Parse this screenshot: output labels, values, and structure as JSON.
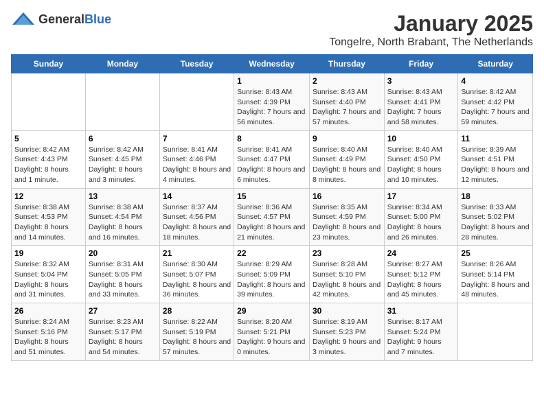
{
  "logo": {
    "general": "General",
    "blue": "Blue"
  },
  "title": "January 2025",
  "subtitle": "Tongelre, North Brabant, The Netherlands",
  "headers": [
    "Sunday",
    "Monday",
    "Tuesday",
    "Wednesday",
    "Thursday",
    "Friday",
    "Saturday"
  ],
  "weeks": [
    [
      {
        "day": "",
        "info": ""
      },
      {
        "day": "",
        "info": ""
      },
      {
        "day": "",
        "info": ""
      },
      {
        "day": "1",
        "info": "Sunrise: 8:43 AM\nSunset: 4:39 PM\nDaylight: 7 hours and 56 minutes."
      },
      {
        "day": "2",
        "info": "Sunrise: 8:43 AM\nSunset: 4:40 PM\nDaylight: 7 hours and 57 minutes."
      },
      {
        "day": "3",
        "info": "Sunrise: 8:43 AM\nSunset: 4:41 PM\nDaylight: 7 hours and 58 minutes."
      },
      {
        "day": "4",
        "info": "Sunrise: 8:42 AM\nSunset: 4:42 PM\nDaylight: 7 hours and 59 minutes."
      }
    ],
    [
      {
        "day": "5",
        "info": "Sunrise: 8:42 AM\nSunset: 4:43 PM\nDaylight: 8 hours and 1 minute."
      },
      {
        "day": "6",
        "info": "Sunrise: 8:42 AM\nSunset: 4:45 PM\nDaylight: 8 hours and 3 minutes."
      },
      {
        "day": "7",
        "info": "Sunrise: 8:41 AM\nSunset: 4:46 PM\nDaylight: 8 hours and 4 minutes."
      },
      {
        "day": "8",
        "info": "Sunrise: 8:41 AM\nSunset: 4:47 PM\nDaylight: 8 hours and 6 minutes."
      },
      {
        "day": "9",
        "info": "Sunrise: 8:40 AM\nSunset: 4:49 PM\nDaylight: 8 hours and 8 minutes."
      },
      {
        "day": "10",
        "info": "Sunrise: 8:40 AM\nSunset: 4:50 PM\nDaylight: 8 hours and 10 minutes."
      },
      {
        "day": "11",
        "info": "Sunrise: 8:39 AM\nSunset: 4:51 PM\nDaylight: 8 hours and 12 minutes."
      }
    ],
    [
      {
        "day": "12",
        "info": "Sunrise: 8:38 AM\nSunset: 4:53 PM\nDaylight: 8 hours and 14 minutes."
      },
      {
        "day": "13",
        "info": "Sunrise: 8:38 AM\nSunset: 4:54 PM\nDaylight: 8 hours and 16 minutes."
      },
      {
        "day": "14",
        "info": "Sunrise: 8:37 AM\nSunset: 4:56 PM\nDaylight: 8 hours and 18 minutes."
      },
      {
        "day": "15",
        "info": "Sunrise: 8:36 AM\nSunset: 4:57 PM\nDaylight: 8 hours and 21 minutes."
      },
      {
        "day": "16",
        "info": "Sunrise: 8:35 AM\nSunset: 4:59 PM\nDaylight: 8 hours and 23 minutes."
      },
      {
        "day": "17",
        "info": "Sunrise: 8:34 AM\nSunset: 5:00 PM\nDaylight: 8 hours and 26 minutes."
      },
      {
        "day": "18",
        "info": "Sunrise: 8:33 AM\nSunset: 5:02 PM\nDaylight: 8 hours and 28 minutes."
      }
    ],
    [
      {
        "day": "19",
        "info": "Sunrise: 8:32 AM\nSunset: 5:04 PM\nDaylight: 8 hours and 31 minutes."
      },
      {
        "day": "20",
        "info": "Sunrise: 8:31 AM\nSunset: 5:05 PM\nDaylight: 8 hours and 33 minutes."
      },
      {
        "day": "21",
        "info": "Sunrise: 8:30 AM\nSunset: 5:07 PM\nDaylight: 8 hours and 36 minutes."
      },
      {
        "day": "22",
        "info": "Sunrise: 8:29 AM\nSunset: 5:09 PM\nDaylight: 8 hours and 39 minutes."
      },
      {
        "day": "23",
        "info": "Sunrise: 8:28 AM\nSunset: 5:10 PM\nDaylight: 8 hours and 42 minutes."
      },
      {
        "day": "24",
        "info": "Sunrise: 8:27 AM\nSunset: 5:12 PM\nDaylight: 8 hours and 45 minutes."
      },
      {
        "day": "25",
        "info": "Sunrise: 8:26 AM\nSunset: 5:14 PM\nDaylight: 8 hours and 48 minutes."
      }
    ],
    [
      {
        "day": "26",
        "info": "Sunrise: 8:24 AM\nSunset: 5:16 PM\nDaylight: 8 hours and 51 minutes."
      },
      {
        "day": "27",
        "info": "Sunrise: 8:23 AM\nSunset: 5:17 PM\nDaylight: 8 hours and 54 minutes."
      },
      {
        "day": "28",
        "info": "Sunrise: 8:22 AM\nSunset: 5:19 PM\nDaylight: 8 hours and 57 minutes."
      },
      {
        "day": "29",
        "info": "Sunrise: 8:20 AM\nSunset: 5:21 PM\nDaylight: 9 hours and 0 minutes."
      },
      {
        "day": "30",
        "info": "Sunrise: 8:19 AM\nSunset: 5:23 PM\nDaylight: 9 hours and 3 minutes."
      },
      {
        "day": "31",
        "info": "Sunrise: 8:17 AM\nSunset: 5:24 PM\nDaylight: 9 hours and 7 minutes."
      },
      {
        "day": "",
        "info": ""
      }
    ]
  ]
}
